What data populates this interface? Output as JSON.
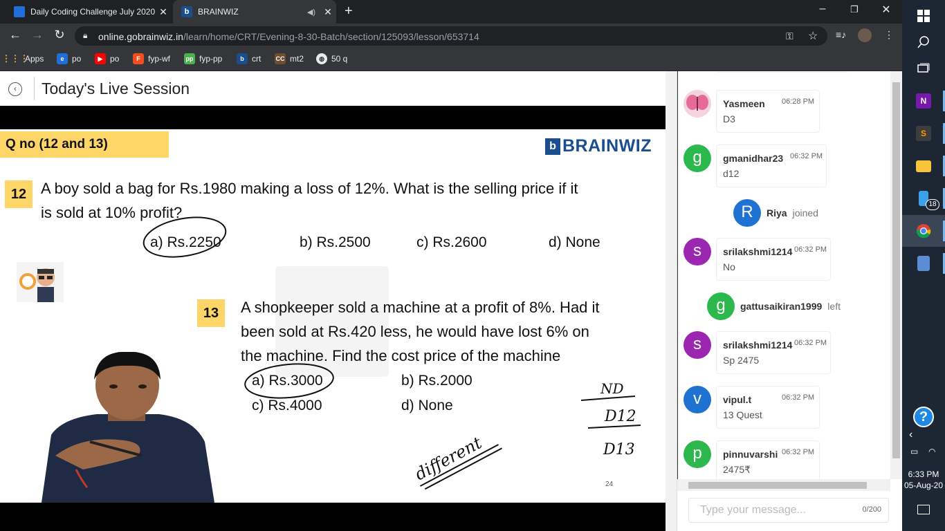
{
  "browser": {
    "tabs": [
      {
        "title": "Daily Coding Challenge July 2020",
        "close": "✕"
      },
      {
        "title": "BRAINWIZ",
        "close": "✕"
      }
    ],
    "new_tab": "+",
    "url_host": "online.gobrainwiz.in",
    "url_path": "/learn/home/CRT/Evening-8-30-Batch/section/125093/lesson/653714",
    "bookmarks": [
      {
        "label": "Apps",
        "icon": "apps-grid-icon"
      },
      {
        "label": "po",
        "icon": "codechef-icon"
      },
      {
        "label": "po",
        "icon": "youtube-icon"
      },
      {
        "label": "fyp-wf",
        "icon": "figma-icon"
      },
      {
        "label": "fyp-pp",
        "icon": "pp-icon"
      },
      {
        "label": "crt",
        "icon": "brainwiz-icon"
      },
      {
        "label": "mt2",
        "icon": "cc-icon"
      },
      {
        "label": "50 q",
        "icon": "globe-icon"
      }
    ]
  },
  "header": {
    "title": "Today's Live Session"
  },
  "slide": {
    "qno_label": "Q no (12 and 13)",
    "brand": "BRAINWIZ",
    "q12": {
      "num": "12",
      "line1": "A boy sold a bag for Rs.1980 making a loss of 12%. What is the selling price if it",
      "line2": "is sold at 10% profit?",
      "options": [
        "a) Rs.2250",
        "b)  Rs.2500",
        "c) Rs.2600",
        "d) None"
      ]
    },
    "q13": {
      "num": "13",
      "line1": "A shopkeeper sold a machine at a profit of 8%. Had it",
      "line2": "been sold at Rs.420 less, he would have lost 6% on",
      "line3": "the machine. Find the cost price of the machine",
      "options": [
        "a) Rs.3000",
        "b)  Rs.2000",
        "c) Rs.4000",
        "d) None"
      ]
    },
    "annotations": {
      "nd": "ND",
      "d12": "D12",
      "d13": "D13",
      "scribble": "different"
    },
    "page_number": "24"
  },
  "chat": {
    "messages": [
      {
        "type": "msg",
        "user": "Yasmeen",
        "time": "06:28 PM",
        "text": "D3",
        "initial": "",
        "color": "#f3b6c9"
      },
      {
        "type": "msg",
        "user": "gmanidhar23",
        "time": "06:32 PM",
        "text": "d12",
        "initial": "g",
        "color": "#2db84d"
      },
      {
        "type": "event",
        "user": "Riya",
        "action": "joined",
        "initial": "R",
        "color": "#1e73d2"
      },
      {
        "type": "msg",
        "user": "srilakshmi1214",
        "time": "06:32 PM",
        "text": "No",
        "initial": "s",
        "color": "#9b27b0"
      },
      {
        "type": "event",
        "user": "gattusaikiran1999",
        "action": "left",
        "initial": "g",
        "color": "#2db84d"
      },
      {
        "type": "msg",
        "user": "srilakshmi1214",
        "time": "06:32 PM",
        "text": "Sp 2475",
        "initial": "s",
        "color": "#9b27b0"
      },
      {
        "type": "msg",
        "user": "vipul.t",
        "time": "06:32 PM",
        "text": "13 Quest",
        "initial": "v",
        "color": "#1e73d2"
      },
      {
        "type": "msg",
        "user": "pinnuvarshi",
        "time": "06:32 PM",
        "text": "2475₹",
        "initial": "p",
        "color": "#2db84d"
      }
    ],
    "input_placeholder": "Type your message...",
    "char_count": "0/200"
  },
  "taskbar": {
    "apps": [
      {
        "icon": "start-icon"
      },
      {
        "icon": "search-icon"
      },
      {
        "icon": "task-view-icon"
      },
      {
        "icon": "onenote-icon",
        "letter": "N",
        "color": "#7719aa"
      },
      {
        "icon": "sublime-icon",
        "letter": "S",
        "color": "#ff9800"
      },
      {
        "icon": "file-explorer-icon",
        "letter": "",
        "color": "#f8c53a"
      },
      {
        "icon": "phone-icon",
        "letter": "",
        "color": "#3aa0e8",
        "badge": "18"
      },
      {
        "icon": "chrome-icon",
        "letter": "",
        "color": "#4caf50"
      },
      {
        "icon": "calculator-icon",
        "letter": "",
        "color": "#5b8dd6"
      }
    ],
    "time": "6:33 PM",
    "date": "05-Aug-20"
  }
}
